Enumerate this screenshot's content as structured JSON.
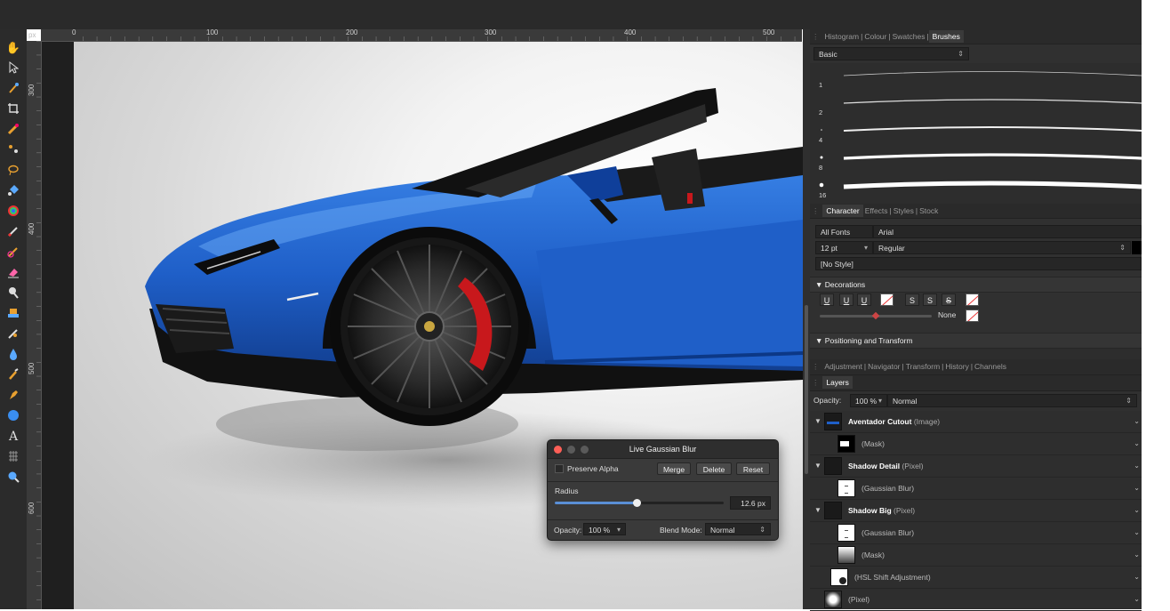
{
  "ruler": {
    "unit": "px",
    "h_labels": [
      "0",
      "100",
      "200",
      "300",
      "400",
      "500"
    ],
    "v_labels": [
      "300",
      "400",
      "500",
      "600"
    ]
  },
  "tools": [
    "hand-icon",
    "move-icon",
    "color-picker-icon",
    "crop-icon",
    "paint-mixer-icon",
    "flood-select-icon",
    "freehand-select-icon",
    "fill-icon",
    "gradient-icon",
    "paint-brush-icon",
    "color-replacement-icon",
    "erase-icon",
    "dodge-icon",
    "clone-icon",
    "healing-icon",
    "blur-icon",
    "smudge-icon",
    "pen-icon",
    "shape-icon",
    "text-icon",
    "mesh-warp-icon",
    "zoom-icon"
  ],
  "panel": {
    "top_tabs": [
      "Histogram",
      "Colour",
      "Swatches",
      "Brushes"
    ],
    "brushes": {
      "category": "Basic",
      "sizes": [
        "1",
        "2",
        "4",
        "8",
        "16"
      ]
    },
    "char_tabs": [
      "Character",
      "Effects",
      "Styles",
      "Stock"
    ],
    "character": {
      "font_collection": "All Fonts",
      "font_family": "Arial",
      "font_size": "12 pt",
      "font_style": "Regular",
      "text_style": "[No Style]"
    },
    "decorations": {
      "header": "Decorations",
      "buttons": [
        "U",
        "U",
        "U",
        "S",
        "S",
        "S"
      ],
      "none_label": "None"
    },
    "positioning_header": "Positioning and Transform",
    "layer_tabs": [
      "Adjustment",
      "Navigator",
      "Transform",
      "History",
      "Channels"
    ],
    "layers_tab": "Layers",
    "opacity_label": "Opacity:",
    "opacity_value": "100 %",
    "blend_mode": "Normal",
    "layers": [
      {
        "name": "Aventador Cutout",
        "type": "(Image)",
        "level": 0,
        "expanded": true
      },
      {
        "name": "(Mask)",
        "type": "",
        "level": 1
      },
      {
        "name": "Shadow Detail",
        "type": "(Pixel)",
        "level": 0,
        "expanded": true
      },
      {
        "name": "(Gaussian Blur)",
        "type": "",
        "level": 1
      },
      {
        "name": "Shadow Big",
        "type": "(Pixel)",
        "level": 0,
        "expanded": true
      },
      {
        "name": "(Gaussian Blur)",
        "type": "",
        "level": 1
      },
      {
        "name": "(Mask)",
        "type": "",
        "level": 1
      },
      {
        "name": "(HSL Shift Adjustment)",
        "type": "",
        "level": 0
      },
      {
        "name": "(Pixel)",
        "type": "",
        "level": 0
      }
    ]
  },
  "dialog": {
    "title": "Live Gaussian Blur",
    "preserve_alpha": "Preserve Alpha",
    "merge": "Merge",
    "delete": "Delete",
    "reset": "Reset",
    "radius_label": "Radius",
    "radius_value": "12.6 px",
    "radius_fraction": 0.36,
    "opacity_label": "Opacity:",
    "opacity_value": "100 %",
    "blend_label": "Blend Mode:",
    "blend_value": "Normal"
  },
  "colors": {
    "accent": "#e8a030",
    "car_blue": "#1f5fc8",
    "brake_red": "#c8181c"
  }
}
